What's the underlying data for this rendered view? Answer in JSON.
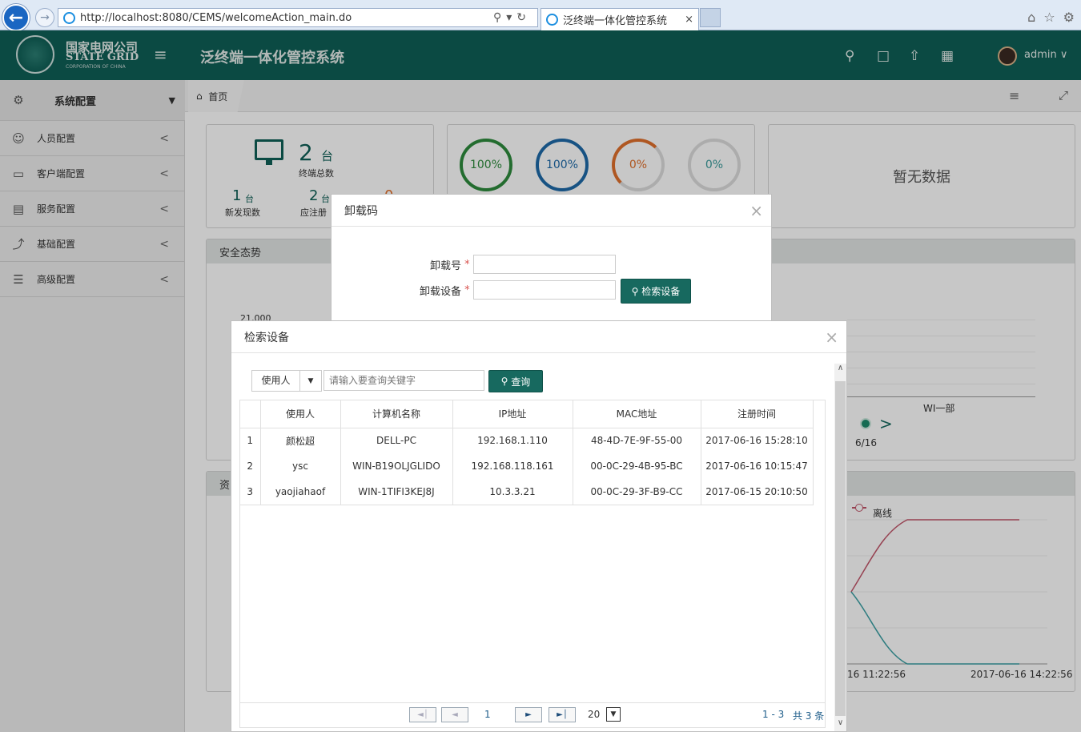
{
  "browser": {
    "url": "http://localhost:8080/CEMS/welcomeAction_main.do",
    "tab_title": "泛终端一体化管控系统",
    "tab_close": "×"
  },
  "header": {
    "logo_cn": "国家电网公司",
    "logo_en": "STATE GRID",
    "logo_sub": "CORPORATION OF CHINA",
    "system_title": "泛终端一体化管控系统",
    "user": "admin"
  },
  "sidebar": {
    "top_label": "系统配置",
    "items": [
      {
        "label": "人员配置",
        "icon": "user-icon"
      },
      {
        "label": "客户端配置",
        "icon": "monitor-icon"
      },
      {
        "label": "服务配置",
        "icon": "server-icon"
      },
      {
        "label": "基础配置",
        "icon": "wrench-icon"
      },
      {
        "label": "高级配置",
        "icon": "list-tree-icon"
      }
    ]
  },
  "breadcrumb": {
    "home": "首页"
  },
  "dashboard": {
    "terminal_count": "2",
    "terminal_unit": "台",
    "terminal_label": "终端总数",
    "new_count": "1",
    "new_unit": "台",
    "new_label": "新发现数",
    "reg_count": "2",
    "reg_unit": "台",
    "reg_label": "应注册",
    "third_count": "0",
    "rings": [
      {
        "value": "100%",
        "color": "#2e8b3d"
      },
      {
        "value": "100%",
        "color": "#1e6aa8"
      },
      {
        "value": "0%",
        "color": "#e0702c"
      },
      {
        "value": "0%",
        "color": "#3c9c9c"
      }
    ],
    "no_data": "暂无数据",
    "security_title": "安全态势",
    "y_tick": "21,000",
    "category": "WI一部",
    "date_short": "6/16",
    "resource_title": "资",
    "legend_offline": "离线",
    "x_tick_1": "16 11:22:56",
    "x_tick_2": "2017-06-16 14:22:56"
  },
  "uninstall_modal": {
    "title": "卸载码",
    "field1_label": "卸载号",
    "field2_label": "卸载设备",
    "required": "*",
    "search_btn": "检索设备"
  },
  "search_modal": {
    "title": "检索设备",
    "filter_select": "使用人",
    "search_placeholder": "请输入要查询关键字",
    "query_btn": "查询",
    "columns": [
      "使用人",
      "计算机名称",
      "IP地址",
      "MAC地址",
      "注册时间"
    ],
    "rows": [
      {
        "idx": "1",
        "user": "颜松超",
        "pc": "DELL-PC",
        "ip": "192.168.1.110",
        "mac": "48-4D-7E-9F-55-00",
        "time": "2017-06-16 15:28:10"
      },
      {
        "idx": "2",
        "user": "ysc",
        "pc": "WIN-B19OLJGLIDO",
        "ip": "192.168.118.161",
        "mac": "00-0C-29-4B-95-BC",
        "time": "2017-06-16 10:15:47"
      },
      {
        "idx": "3",
        "user": "yaojiahaof",
        "pc": "WIN-1TIFI3KEJ8J",
        "ip": "10.3.3.21",
        "mac": "00-0C-29-3F-B9-CC",
        "time": "2017-06-15 20:10:50"
      }
    ],
    "pager": {
      "page": "1",
      "page_size": "20",
      "range": "1 - 3",
      "total": "共 3 条"
    }
  }
}
